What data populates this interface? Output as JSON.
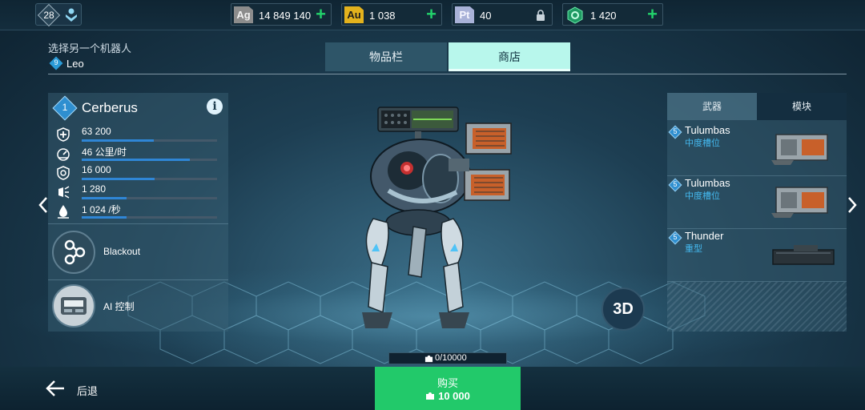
{
  "topbar": {
    "level": "28",
    "currencies": [
      {
        "badge": "Ag",
        "value": "14 849 140",
        "badge_color": "#8c8c8c",
        "action": "+"
      },
      {
        "badge": "Au",
        "value": "1 038",
        "badge_color": "#e3b21d",
        "action": "+"
      },
      {
        "badge": "Pt",
        "value": "40",
        "badge_color": "#a9b2d8",
        "action": "lock"
      },
      {
        "badge": "",
        "value": "1 420",
        "badge_color": "#23c47a",
        "action": "+"
      }
    ]
  },
  "robot_select": {
    "label": "选择另一个机器人",
    "robot_level": "9",
    "robot_name": "Leo"
  },
  "tabs": {
    "inventory": "物品栏",
    "shop": "商店"
  },
  "robot": {
    "level": "1",
    "name": "Cerberus",
    "stats": [
      {
        "icon": "shield-plus-icon",
        "value": "63 200",
        "fill": 0.53
      },
      {
        "icon": "speedometer-icon",
        "value": "46 公里/时",
        "fill": 0.8
      },
      {
        "icon": "energy-shield-icon",
        "value": "16 000",
        "fill": 0.54
      },
      {
        "icon": "damage-icon",
        "value": "1 280",
        "fill": 0.33
      },
      {
        "icon": "flame-drop-icon",
        "value": "1 024 /秒",
        "fill": 0.33
      }
    ],
    "abilities": [
      {
        "icon": "blackout-icon",
        "label": "Blackout"
      },
      {
        "icon": "ai-control-icon",
        "label": "AI 控制"
      }
    ]
  },
  "weapons_panel": {
    "tab_weapons": "武器",
    "tab_modules": "模块",
    "items": [
      {
        "level": "5",
        "name": "Tulumbas",
        "slot": "中度槽位"
      },
      {
        "level": "5",
        "name": "Tulumbas",
        "slot": "中度槽位"
      },
      {
        "level": "5",
        "name": "Thunder",
        "slot": "重型"
      }
    ]
  },
  "view_toggle": "3D",
  "parts": {
    "progress": "0/10000",
    "fill": 0.0
  },
  "bottom": {
    "back_label": "后退",
    "buy_label": "购买",
    "buy_price": "10 000"
  },
  "colors": {
    "accent_green": "#22c96a",
    "shop_tab": "#b8f7ec",
    "stat_bar": "#2f86d6"
  }
}
